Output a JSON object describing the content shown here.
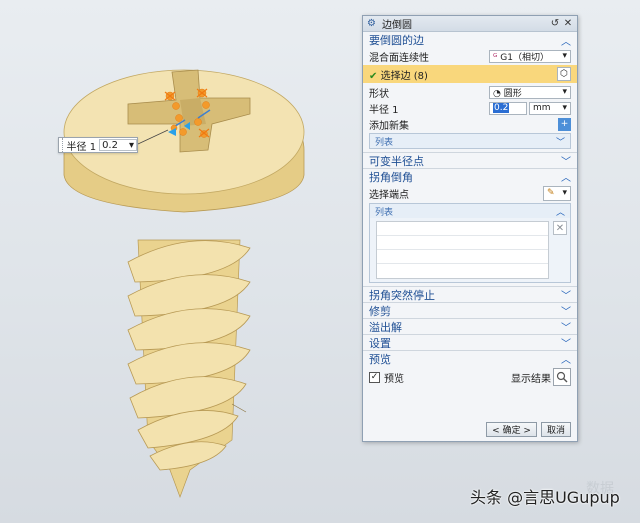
{
  "float_input": {
    "label": "半径 1",
    "value": "0.2"
  },
  "dialog": {
    "title": "边倒圆",
    "section_edge": {
      "title": "要倒圆的边",
      "continuity_label": "混合面连续性",
      "continuity_value": "G1（相切）",
      "select_edge_label": "选择边 (8)",
      "shape_label": "形状",
      "shape_value": "圆形",
      "radius_label": "半径 1",
      "radius_value": "0.2",
      "radius_unit": "mm",
      "add_new_set_label": "添加新集",
      "list_label": "列表"
    },
    "section_variable": {
      "title": "可变半径点"
    },
    "section_corner": {
      "title": "拐角倒角",
      "select_vertex_label": "选择端点",
      "list_label": "列表"
    },
    "section_corner_stop": {
      "title": "拐角突然停止"
    },
    "section_trim": {
      "title": "修剪"
    },
    "section_overflow": {
      "title": "溢出解"
    },
    "section_settings": {
      "title": "设置"
    },
    "section_preview": {
      "title": "预览",
      "preview_checkbox_label": "预览",
      "show_result_label": "显示结果"
    },
    "ok_label": "< 确定 >",
    "cancel_label": "取消"
  },
  "watermark": {
    "text": "头条 @言思UGupup",
    "ghost": "数据"
  },
  "colors": {
    "screw_body": "#f1dfa6",
    "screw_shade": "#d8c07f",
    "accent_blue": "#1f5fb8",
    "selection_yellow": "#f9d77c",
    "handle_orange": "#f39a2b"
  }
}
